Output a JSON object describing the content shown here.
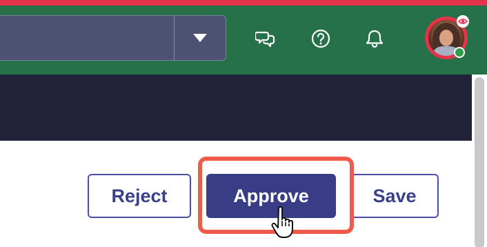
{
  "header": {
    "search": {
      "value": "",
      "placeholder": ""
    },
    "icons": [
      "chat-icon",
      "help-icon",
      "bell-icon"
    ]
  },
  "actions": {
    "reject_label": "Reject",
    "approve_label": "Approve",
    "save_label": "Save"
  },
  "colors": {
    "top_strip": "#e3344a",
    "header_bg": "#27714a",
    "navbar_bg": "#22233a",
    "primary": "#393d86",
    "highlight": "#ef5b4a",
    "status_online": "#2e9e4e"
  }
}
